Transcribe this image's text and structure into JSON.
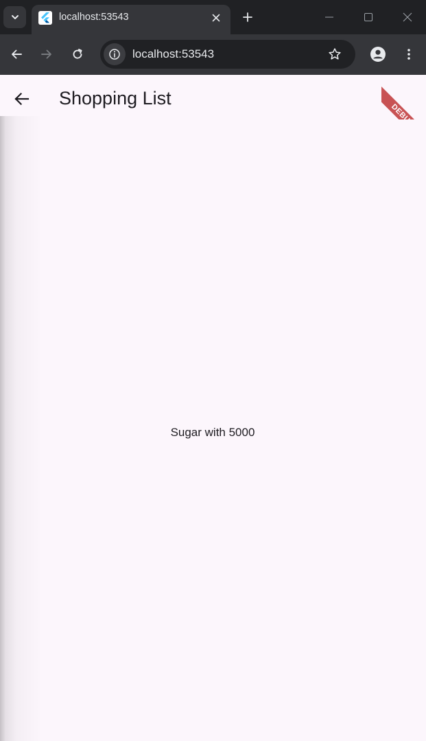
{
  "browser": {
    "tab": {
      "title": "localhost:53543",
      "favicon": "flutter-logo-icon"
    },
    "address_bar": {
      "url": "localhost:53543"
    },
    "icons": {
      "tab_search": "chevron-down-icon",
      "tab_close": "close-icon",
      "new_tab": "plus-icon",
      "minimize": "minimize-icon",
      "maximize": "maximize-icon",
      "window_close": "close-icon",
      "back": "arrow-left-icon",
      "forward": "arrow-right-icon",
      "reload": "reload-icon",
      "site_info": "info-icon",
      "bookmark": "star-icon",
      "profile": "person-icon",
      "menu": "more-vertical-icon"
    },
    "colors": {
      "tabstrip": "#202124",
      "toolbar": "#35363a",
      "omnibox": "#202124"
    }
  },
  "app": {
    "appbar": {
      "title": "Shopping List",
      "back_icon": "arrow-left-icon"
    },
    "body_text": "Sugar with 5000",
    "debug_banner": "DEBUG",
    "colors": {
      "background": "#fcf6fc",
      "text": "#1d1b20",
      "debug_banner": "#b71c1c"
    }
  }
}
